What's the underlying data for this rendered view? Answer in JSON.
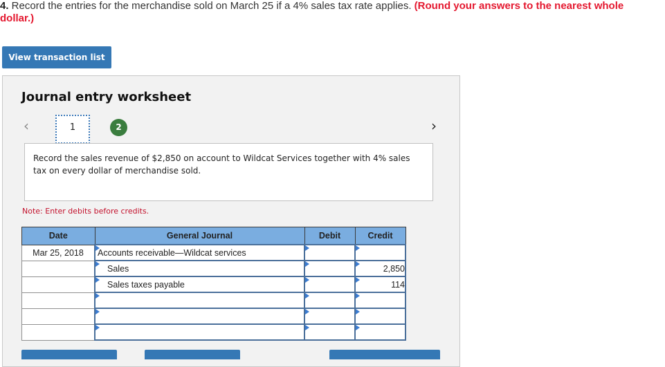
{
  "question": {
    "number": "4.",
    "text": " Record the entries for the merchandise sold on March 25 if a 4% sales tax rate applies. ",
    "hint": "(Round your answers to the nearest whole dollar.)"
  },
  "view_transaction_button": "View transaction list",
  "worksheet": {
    "title": "Journal entry worksheet",
    "nav_prev_icon": "‹",
    "nav_next_icon": "›",
    "steps": [
      "1",
      "2"
    ],
    "active_step": "1",
    "description": "Record the sales revenue of $2,850 on account to Wildcat Services together with 4% sales tax on every dollar of merchandise sold.",
    "note": "Note: Enter debits before credits.",
    "table": {
      "headers": [
        "Date",
        "General Journal",
        "Debit",
        "Credit"
      ],
      "rows": [
        {
          "date": "Mar 25, 2018",
          "account": "Accounts receivable—Wildcat services",
          "debit": "",
          "credit": ""
        },
        {
          "date": "",
          "account": "Sales",
          "debit": "",
          "credit": "2,850"
        },
        {
          "date": "",
          "account": "Sales taxes payable",
          "debit": "",
          "credit": "114"
        },
        {
          "date": "",
          "account": "",
          "debit": "",
          "credit": ""
        },
        {
          "date": "",
          "account": "",
          "debit": "",
          "credit": ""
        },
        {
          "date": "",
          "account": "",
          "debit": "",
          "credit": ""
        }
      ]
    }
  },
  "colors": {
    "primary_button": "#3578b5",
    "table_header": "#7aade0",
    "hint_red": "#e4182f",
    "step_complete": "#3a7d3e"
  }
}
